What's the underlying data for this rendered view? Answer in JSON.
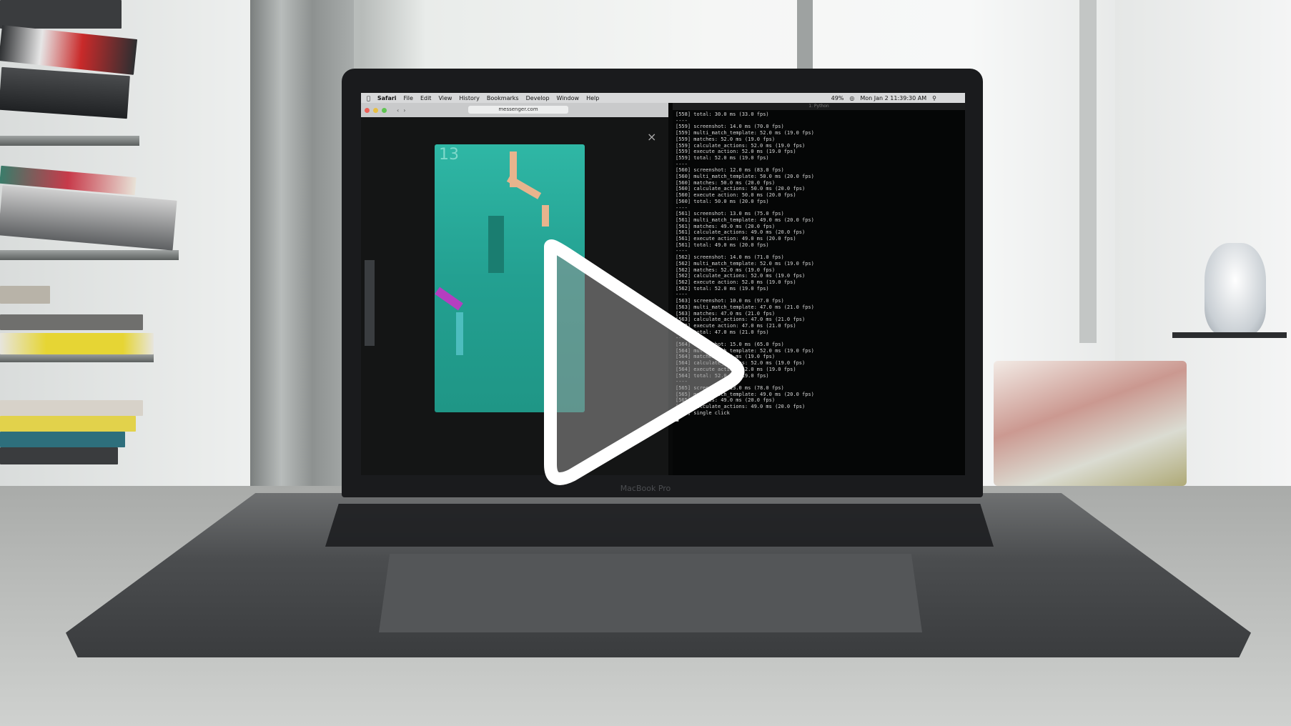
{
  "menubar": {
    "app": "Safari",
    "items": [
      "File",
      "Edit",
      "View",
      "History",
      "Bookmarks",
      "Develop",
      "Window",
      "Help"
    ],
    "clock": "Mon Jan 2  11:39:30 AM",
    "battery": "49%"
  },
  "safari": {
    "url": "messenger.com",
    "close_glyph": "×"
  },
  "game": {
    "score": "13"
  },
  "terminal": {
    "title": "1. Python",
    "lines": [
      "[558] total: 30.0 ms (33.0 fps)",
      "----",
      "[559] screenshot: 14.0 ms (70.0 fps)",
      "[559] multi_match_template: 52.0 ms (19.0 fps)",
      "[559] matches: 52.0 ms (19.0 fps)",
      "[559] calculate_actions: 52.0 ms (19.0 fps)",
      "[559] execute action: 52.0 ms (19.0 fps)",
      "[559] total: 52.0 ms (19.0 fps)",
      "----",
      "[560] screenshot: 12.0 ms (83.0 fps)",
      "[560] multi_match_template: 50.0 ms (20.0 fps)",
      "[560] matches: 50.0 ms (20.0 fps)",
      "[560] calculate_actions: 50.0 ms (20.0 fps)",
      "[560] execute action: 50.0 ms (20.0 fps)",
      "[560] total: 50.0 ms (20.0 fps)",
      "----",
      "[561] screenshot: 13.0 ms (75.0 fps)",
      "[561] multi_match_template: 49.0 ms (20.0 fps)",
      "[561] matches: 49.0 ms (20.0 fps)",
      "[561] calculate_actions: 49.0 ms (20.0 fps)",
      "[561] execute action: 49.0 ms (20.0 fps)",
      "[561] total: 49.0 ms (20.0 fps)",
      "----",
      "[562] screenshot: 14.0 ms (71.0 fps)",
      "[562] multi_match_template: 52.0 ms (19.0 fps)",
      "[562] matches: 52.0 ms (19.0 fps)",
      "[562] calculate_actions: 52.0 ms (19.0 fps)",
      "[562] execute action: 52.0 ms (19.0 fps)",
      "[562] total: 52.0 ms (19.0 fps)",
      "----",
      "[563] screenshot: 10.0 ms (97.0 fps)",
      "[563] multi_match_template: 47.0 ms (21.0 fps)",
      "[563] matches: 47.0 ms (21.0 fps)",
      "[563] calculate_actions: 47.0 ms (21.0 fps)",
      "[563] execute action: 47.0 ms (21.0 fps)",
      "[563] total: 47.0 ms (21.0 fps)",
      "----",
      "[564] screenshot: 15.0 ms (65.0 fps)",
      "[564] multi_match_template: 52.0 ms (19.0 fps)",
      "[564] matches: 52.0 ms (19.0 fps)",
      "[564] calculate_actions: 52.0 ms (19.0 fps)",
      "[564] execute action: 52.0 ms (19.0 fps)",
      "[564] total: 52.0 ms (19.0 fps)",
      "----",
      "[565] screenshot: 13.0 ms (78.0 fps)",
      "[565] multi_match_template: 49.0 ms (20.0 fps)",
      "[565] matches: 49.0 ms (20.0 fps)",
      "[565] calculate_actions: 49.0 ms (20.0 fps)",
      "[565] single click",
      "█"
    ]
  },
  "laptop": {
    "brand": "MacBook Pro"
  },
  "overlay": {
    "icon": "play-icon"
  }
}
